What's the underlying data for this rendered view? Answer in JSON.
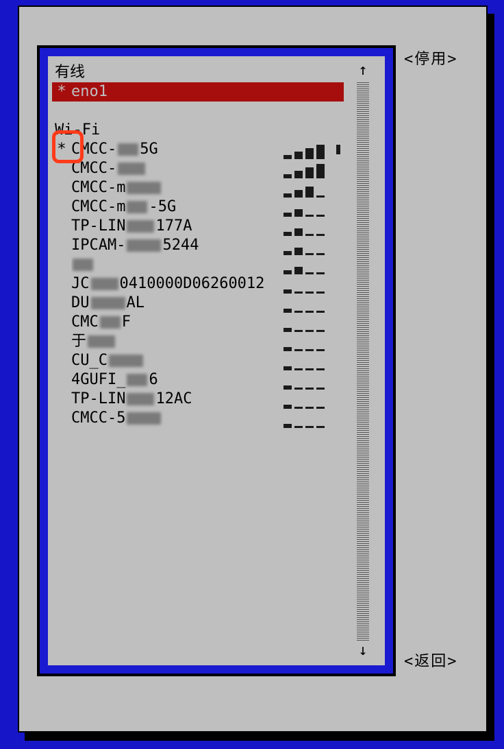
{
  "sections": {
    "wired": {
      "title": "有线"
    },
    "wifi": {
      "title": "Wi-Fi"
    }
  },
  "wired_entries": [
    {
      "name": "eno1",
      "active": true,
      "selected": true
    }
  ],
  "wifi_entries": [
    {
      "name_prefix": "CMCC-",
      "name_suffix": "5G",
      "active": true,
      "signal": 4,
      "secure": true
    },
    {
      "name_prefix": "CMCC-",
      "name_suffix": "",
      "active": false,
      "signal": 4,
      "secure": false
    },
    {
      "name_prefix": "CMCC-m",
      "name_suffix": "",
      "active": false,
      "signal": 3,
      "secure": false
    },
    {
      "name_prefix": "CMCC-m",
      "name_suffix": "-5G",
      "active": false,
      "signal": 2,
      "secure": false
    },
    {
      "name_prefix": "TP-LIN",
      "name_suffix": "177A",
      "active": false,
      "signal": 2,
      "secure": false
    },
    {
      "name_prefix": "IPCAM-",
      "name_suffix": "5244",
      "active": false,
      "signal": 2,
      "secure": false
    },
    {
      "name_prefix": "",
      "name_suffix": "",
      "active": false,
      "signal": 2,
      "secure": false
    },
    {
      "name_prefix": "JC",
      "name_suffix": "0410000D06260012",
      "active": false,
      "signal": 1,
      "secure": false
    },
    {
      "name_prefix": "DU",
      "name_suffix": "AL",
      "active": false,
      "signal": 1,
      "secure": false
    },
    {
      "name_prefix": "CMC",
      "name_suffix": "F",
      "active": false,
      "signal": 1,
      "secure": false
    },
    {
      "name_prefix": "于",
      "name_suffix": "",
      "active": false,
      "signal": 1,
      "secure": false
    },
    {
      "name_prefix": "CU_C",
      "name_suffix": "",
      "active": false,
      "signal": 1,
      "secure": false
    },
    {
      "name_prefix": "4GUFI_",
      "name_suffix": "6",
      "active": false,
      "signal": 1,
      "secure": false
    },
    {
      "name_prefix": "TP-LIN",
      "name_suffix": "12AC",
      "active": false,
      "signal": 1,
      "secure": false
    },
    {
      "name_prefix": "CMCC-5",
      "name_suffix": "",
      "active": false,
      "signal": 1,
      "secure": false
    }
  ],
  "actions": {
    "disable": "<停用>",
    "back": "<返回>"
  },
  "scroll": {
    "up_arrow": "↑",
    "down_arrow": "↓"
  },
  "marker": {
    "active": "*"
  }
}
